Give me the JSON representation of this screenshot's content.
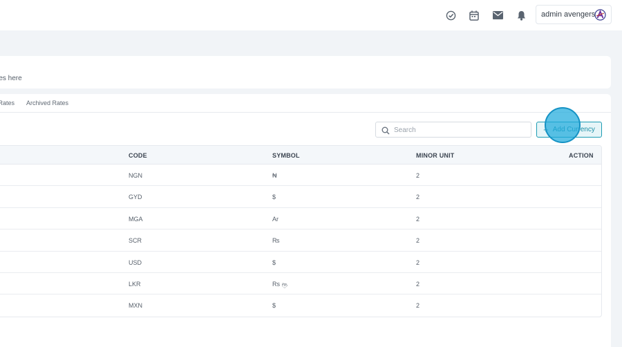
{
  "header": {
    "icons": [
      "check-circle-icon",
      "calendar-icon",
      "mail-icon",
      "bell-icon"
    ],
    "user_name": "admin avengers"
  },
  "intro": {
    "subtitle_partial": "ates here"
  },
  "tabs": [
    {
      "label": "e Rates"
    },
    {
      "label": "Archived Rates"
    }
  ],
  "search": {
    "placeholder": "Search",
    "value": ""
  },
  "add_button": {
    "label": "Add Currency",
    "accent": "#1b9bb3"
  },
  "table": {
    "columns": [
      "CODE",
      "SYMBOL",
      "MINOR UNIT",
      "ACTION"
    ],
    "rows": [
      {
        "code": "NGN",
        "symbol": "₦",
        "minor_unit": "2"
      },
      {
        "code": "GYD",
        "symbol": "$",
        "minor_unit": "2"
      },
      {
        "code": "MGA",
        "symbol": "Ar",
        "minor_unit": "2"
      },
      {
        "code": "SCR",
        "symbol": "₨",
        "minor_unit": "2"
      },
      {
        "code": "USD",
        "symbol": "$",
        "minor_unit": "2"
      },
      {
        "code": "LKR",
        "symbol": "Rs ரூ",
        "minor_unit": "2"
      },
      {
        "code": "MXN",
        "symbol": "$",
        "minor_unit": "2"
      }
    ]
  }
}
